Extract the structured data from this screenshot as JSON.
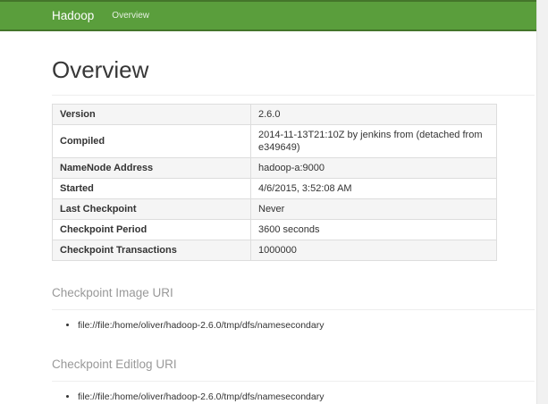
{
  "colors": {
    "navbar_bg": "#5a9e3c",
    "navbar_border": "#44752a",
    "navbar_brand_text": "#ffffff",
    "muted_heading": "#999999",
    "table_border": "#dddddd",
    "table_stripe": "#f5f5f5",
    "body_text": "#333333",
    "scroll_track": "#f1f1f1"
  },
  "navbar": {
    "brand": "Hadoop",
    "items": [
      {
        "label": "Overview"
      }
    ]
  },
  "page": {
    "title": "Overview"
  },
  "overview_table": {
    "rows": [
      {
        "label": "Version",
        "value": "2.6.0"
      },
      {
        "label": "Compiled",
        "value": "2014-11-13T21:10Z by jenkins from (detached from e349649)"
      },
      {
        "label": "NameNode Address",
        "value": "hadoop-a:9000"
      },
      {
        "label": "Started",
        "value": "4/6/2015, 3:52:08 AM"
      },
      {
        "label": "Last Checkpoint",
        "value": "Never"
      },
      {
        "label": "Checkpoint Period",
        "value": "3600 seconds"
      },
      {
        "label": "Checkpoint Transactions",
        "value": "1000000"
      }
    ]
  },
  "sections": [
    {
      "title": "Checkpoint Image URI",
      "items": [
        "file://file:/home/oliver/hadoop-2.6.0/tmp/dfs/namesecondary"
      ]
    },
    {
      "title": "Checkpoint Editlog URI",
      "items": [
        "file://file:/home/oliver/hadoop-2.6.0/tmp/dfs/namesecondary"
      ]
    }
  ]
}
